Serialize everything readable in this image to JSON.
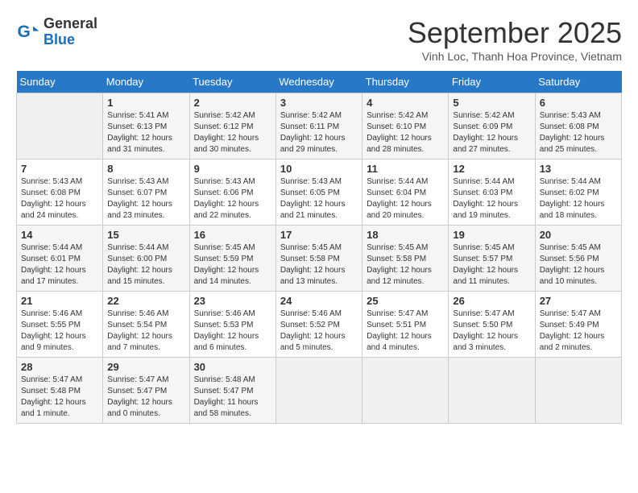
{
  "header": {
    "logo_general": "General",
    "logo_blue": "Blue",
    "month_title": "September 2025",
    "location": "Vinh Loc, Thanh Hoa Province, Vietnam"
  },
  "weekdays": [
    "Sunday",
    "Monday",
    "Tuesday",
    "Wednesday",
    "Thursday",
    "Friday",
    "Saturday"
  ],
  "weeks": [
    [
      {
        "day": "",
        "info": ""
      },
      {
        "day": "1",
        "info": "Sunrise: 5:41 AM\nSunset: 6:13 PM\nDaylight: 12 hours\nand 31 minutes."
      },
      {
        "day": "2",
        "info": "Sunrise: 5:42 AM\nSunset: 6:12 PM\nDaylight: 12 hours\nand 30 minutes."
      },
      {
        "day": "3",
        "info": "Sunrise: 5:42 AM\nSunset: 6:11 PM\nDaylight: 12 hours\nand 29 minutes."
      },
      {
        "day": "4",
        "info": "Sunrise: 5:42 AM\nSunset: 6:10 PM\nDaylight: 12 hours\nand 28 minutes."
      },
      {
        "day": "5",
        "info": "Sunrise: 5:42 AM\nSunset: 6:09 PM\nDaylight: 12 hours\nand 27 minutes."
      },
      {
        "day": "6",
        "info": "Sunrise: 5:43 AM\nSunset: 6:08 PM\nDaylight: 12 hours\nand 25 minutes."
      }
    ],
    [
      {
        "day": "7",
        "info": "Sunrise: 5:43 AM\nSunset: 6:08 PM\nDaylight: 12 hours\nand 24 minutes."
      },
      {
        "day": "8",
        "info": "Sunrise: 5:43 AM\nSunset: 6:07 PM\nDaylight: 12 hours\nand 23 minutes."
      },
      {
        "day": "9",
        "info": "Sunrise: 5:43 AM\nSunset: 6:06 PM\nDaylight: 12 hours\nand 22 minutes."
      },
      {
        "day": "10",
        "info": "Sunrise: 5:43 AM\nSunset: 6:05 PM\nDaylight: 12 hours\nand 21 minutes."
      },
      {
        "day": "11",
        "info": "Sunrise: 5:44 AM\nSunset: 6:04 PM\nDaylight: 12 hours\nand 20 minutes."
      },
      {
        "day": "12",
        "info": "Sunrise: 5:44 AM\nSunset: 6:03 PM\nDaylight: 12 hours\nand 19 minutes."
      },
      {
        "day": "13",
        "info": "Sunrise: 5:44 AM\nSunset: 6:02 PM\nDaylight: 12 hours\nand 18 minutes."
      }
    ],
    [
      {
        "day": "14",
        "info": "Sunrise: 5:44 AM\nSunset: 6:01 PM\nDaylight: 12 hours\nand 17 minutes."
      },
      {
        "day": "15",
        "info": "Sunrise: 5:44 AM\nSunset: 6:00 PM\nDaylight: 12 hours\nand 15 minutes."
      },
      {
        "day": "16",
        "info": "Sunrise: 5:45 AM\nSunset: 5:59 PM\nDaylight: 12 hours\nand 14 minutes."
      },
      {
        "day": "17",
        "info": "Sunrise: 5:45 AM\nSunset: 5:58 PM\nDaylight: 12 hours\nand 13 minutes."
      },
      {
        "day": "18",
        "info": "Sunrise: 5:45 AM\nSunset: 5:58 PM\nDaylight: 12 hours\nand 12 minutes."
      },
      {
        "day": "19",
        "info": "Sunrise: 5:45 AM\nSunset: 5:57 PM\nDaylight: 12 hours\nand 11 minutes."
      },
      {
        "day": "20",
        "info": "Sunrise: 5:45 AM\nSunset: 5:56 PM\nDaylight: 12 hours\nand 10 minutes."
      }
    ],
    [
      {
        "day": "21",
        "info": "Sunrise: 5:46 AM\nSunset: 5:55 PM\nDaylight: 12 hours\nand 9 minutes."
      },
      {
        "day": "22",
        "info": "Sunrise: 5:46 AM\nSunset: 5:54 PM\nDaylight: 12 hours\nand 7 minutes."
      },
      {
        "day": "23",
        "info": "Sunrise: 5:46 AM\nSunset: 5:53 PM\nDaylight: 12 hours\nand 6 minutes."
      },
      {
        "day": "24",
        "info": "Sunrise: 5:46 AM\nSunset: 5:52 PM\nDaylight: 12 hours\nand 5 minutes."
      },
      {
        "day": "25",
        "info": "Sunrise: 5:47 AM\nSunset: 5:51 PM\nDaylight: 12 hours\nand 4 minutes."
      },
      {
        "day": "26",
        "info": "Sunrise: 5:47 AM\nSunset: 5:50 PM\nDaylight: 12 hours\nand 3 minutes."
      },
      {
        "day": "27",
        "info": "Sunrise: 5:47 AM\nSunset: 5:49 PM\nDaylight: 12 hours\nand 2 minutes."
      }
    ],
    [
      {
        "day": "28",
        "info": "Sunrise: 5:47 AM\nSunset: 5:48 PM\nDaylight: 12 hours\nand 1 minute."
      },
      {
        "day": "29",
        "info": "Sunrise: 5:47 AM\nSunset: 5:47 PM\nDaylight: 12 hours\nand 0 minutes."
      },
      {
        "day": "30",
        "info": "Sunrise: 5:48 AM\nSunset: 5:47 PM\nDaylight: 11 hours\nand 58 minutes."
      },
      {
        "day": "",
        "info": ""
      },
      {
        "day": "",
        "info": ""
      },
      {
        "day": "",
        "info": ""
      },
      {
        "day": "",
        "info": ""
      }
    ]
  ]
}
